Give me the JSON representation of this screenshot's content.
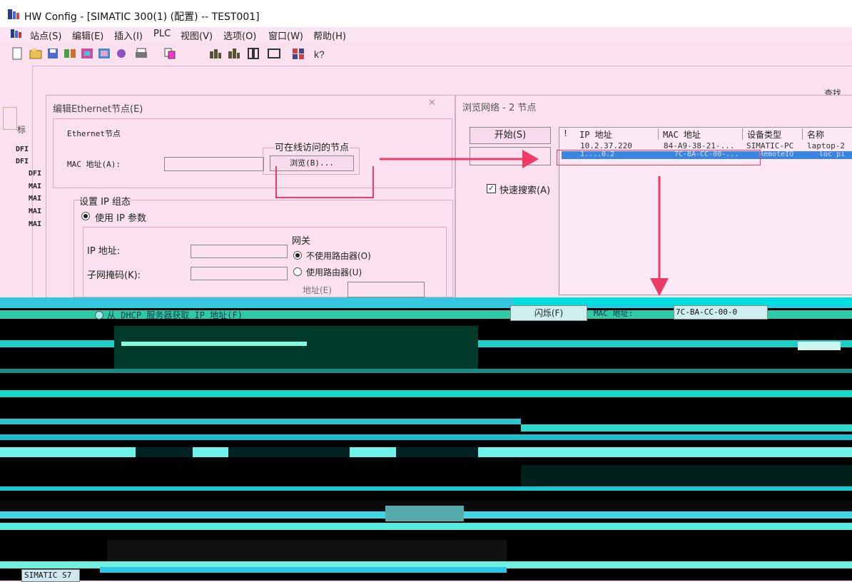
{
  "window": {
    "title": "HW Config - [SIMATIC 300(1) (配置) -- TEST001]"
  },
  "menu": [
    "站点(S)",
    "编辑(E)",
    "插入(I)",
    "PLC",
    "视图(V)",
    "选项(O)",
    "窗口(W)",
    "帮助(H)"
  ],
  "right_edge_label": "查找",
  "left_panel": {
    "header": "标",
    "rows": [
      "DFI",
      "DFI",
      "DFI",
      "MAI",
      "MAI",
      "MAI",
      "MAI"
    ]
  },
  "edit_dialog": {
    "title": "编辑Ethernet节点(E)",
    "group_node": "Ethernet节点",
    "mac_label": "MAC 地址(A):",
    "online_label": "可在线访问的节点",
    "browse_button": "浏览(B)...",
    "group_ip": "设置 IP 组态",
    "use_ip": "使用 IP 参数",
    "ip_label": "IP 地址:",
    "subnet_label": "子网掩码(K):",
    "gateway_label": "网关",
    "no_router": "不使用路由器(O)",
    "use_router": "使用路由器(U)",
    "address_label": "地址(E)",
    "dhcp_option": "从 DHCP 服务器获取 IP 地址(F)"
  },
  "browse_dialog": {
    "title": "浏览网络 - 2 节点",
    "start_button": "开始(S)",
    "quick_search": "快速搜索(A)",
    "columns": [
      "!",
      "IP 地址",
      "MAC 地址",
      "设备类型",
      "名称"
    ],
    "rows": [
      {
        "ip": "10.2.37.220",
        "mac": "84-A9-38-21-...",
        "type": "SIMATIC-PC",
        "name": "laptop-2"
      },
      {
        "ip": "1....0.2",
        "mac": "7C-BA-CC-00-...",
        "type": "RemoteIO",
        "name": "loc pi"
      }
    ],
    "flash_button": "闪烁(F)",
    "mac_label": "MAC 地址:",
    "mac_value": "7C-BA-CC-00-0"
  },
  "status": {
    "station": "SIMATIC S7"
  },
  "colors": {
    "annotation": "#ec3b66",
    "selection": "#3b86e0",
    "background": "#fbe1f0"
  }
}
